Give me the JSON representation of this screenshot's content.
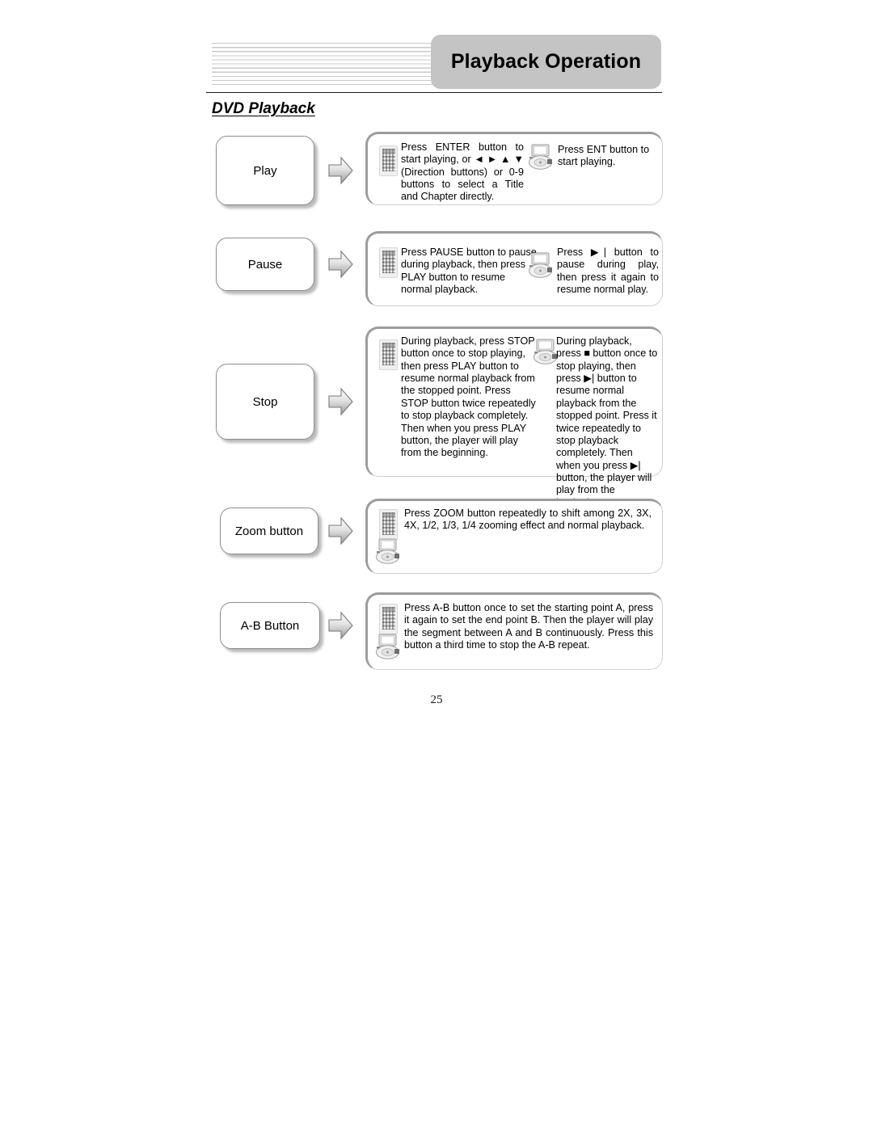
{
  "header": {
    "title": "Playback Operation",
    "stripes_icon": "stripe-decoration"
  },
  "section": {
    "title": "DVD Playback"
  },
  "icons": {
    "remote": "remote-control-icon",
    "player": "dvd-player-icon",
    "arrow": "right-block-arrow-icon"
  },
  "rows": [
    {
      "label": "Play",
      "remote_text": "Press ENTER button to start playing, or ◄ ► ▲ ▼ (Direction buttons) or 0-9 buttons to select a Title and Chapter directly.",
      "player_text": "Press ENT button to start playing."
    },
    {
      "label": "Pause",
      "remote_text": "Press PAUSE button to pause during playback, then press PLAY button to resume normal playback.",
      "player_text": "Press ▶| button to pause during play, then press it again to resume normal play."
    },
    {
      "label": "Stop",
      "remote_text": "During playback, press STOP button once to stop playing, then press PLAY button to resume normal playback from the stopped point. Press STOP button twice repeatedly to stop playback completely. Then when you press PLAY button, the player will play from the beginning.",
      "player_text": "During playback, press ■ button once to stop playing, then press ▶| button to resume normal playback from the stopped point. Press it twice repeatedly to stop playback completely. Then when you press ▶| button, the player will play from the beginning."
    },
    {
      "label": "Zoom button",
      "text": "Press ZOOM button repeatedly to shift among 2X, 3X, 4X, 1/2, 1/3, 1/4 zooming effect and normal playback."
    },
    {
      "label": "A-B Button",
      "text": "Press A-B button once to set the starting point A, press it again to set the end point B. Then the player will play the segment between A and B continuously. Press this button a third time to stop the A-B repeat."
    }
  ],
  "page_number": "25"
}
